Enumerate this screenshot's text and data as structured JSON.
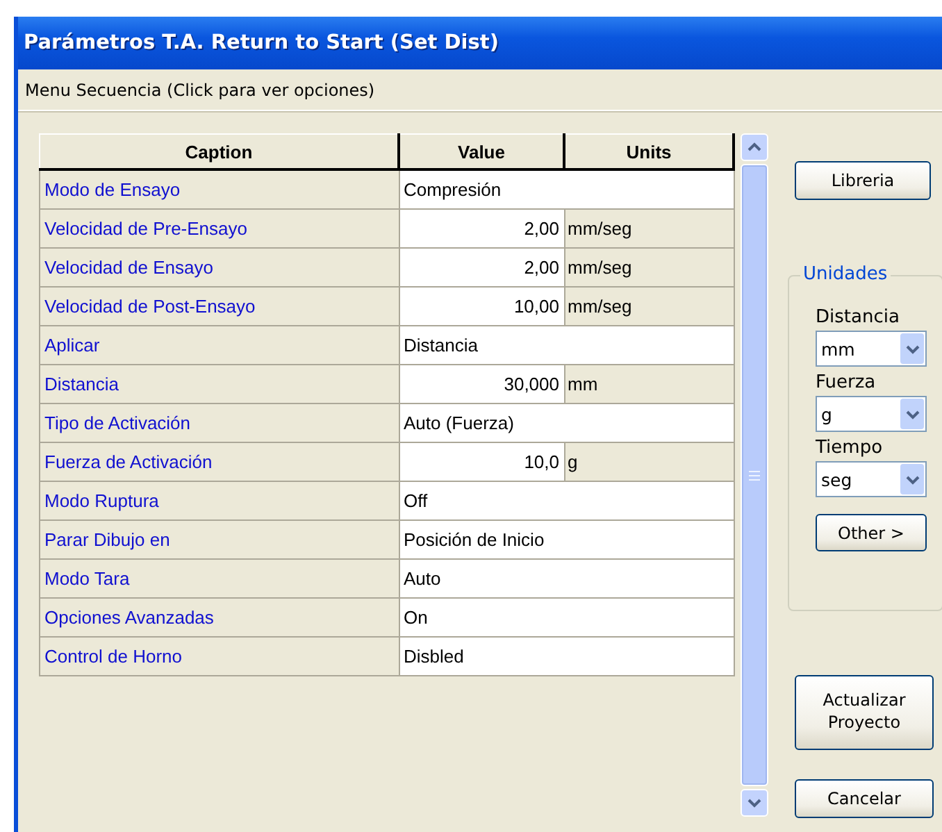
{
  "window": {
    "title": "Parámetros T.A. Return to Start (Set Dist)"
  },
  "menu": {
    "label": "Menu Secuencia  (Click para ver opciones)"
  },
  "table": {
    "columns": [
      "Caption",
      "Value",
      "Units"
    ],
    "rows": [
      {
        "kind": "text",
        "caption": "Modo de Ensayo",
        "value": "Compresión"
      },
      {
        "kind": "number",
        "caption": "Velocidad de Pre-Ensayo",
        "value": "2,00",
        "units": "mm/seg"
      },
      {
        "kind": "number",
        "caption": "Velocidad de Ensayo",
        "value": "2,00",
        "units": "mm/seg"
      },
      {
        "kind": "number",
        "caption": "Velocidad de Post-Ensayo",
        "value": "10,00",
        "units": "mm/seg"
      },
      {
        "kind": "text",
        "caption": "Aplicar",
        "value": "Distancia"
      },
      {
        "kind": "number",
        "caption": "Distancia",
        "value": "30,000",
        "units": "mm"
      },
      {
        "kind": "text",
        "caption": "Tipo de Activación",
        "value": "Auto (Fuerza)"
      },
      {
        "kind": "number",
        "caption": "Fuerza de Activación",
        "value": "10,0",
        "units": "g"
      },
      {
        "kind": "text",
        "caption": "Modo Ruptura",
        "value": "Off"
      },
      {
        "kind": "text",
        "caption": "Parar Dibujo en",
        "value": "Posición de Inicio"
      },
      {
        "kind": "text",
        "caption": "Modo Tara",
        "value": "Auto"
      },
      {
        "kind": "text",
        "caption": "Opciones Avanzadas",
        "value": "On"
      },
      {
        "kind": "text",
        "caption": "Control de Horno",
        "value": "Disbled"
      }
    ]
  },
  "library_button": "Libreria",
  "units_group": {
    "title": "Unidades",
    "fields": [
      {
        "label": "Distancia",
        "value": "mm"
      },
      {
        "label": "Fuerza",
        "value": "g"
      },
      {
        "label": "Tiempo",
        "value": "seg"
      }
    ],
    "other_button": "Other  >"
  },
  "update_button": "Actualizar Proyecto",
  "cancel_button": "Cancelar"
}
